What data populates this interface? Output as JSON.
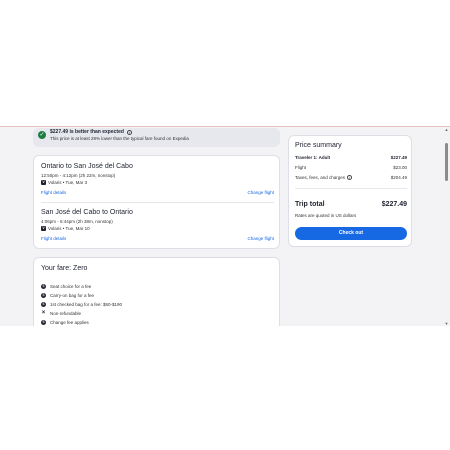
{
  "banner": {
    "title": "$227.49 is better than expected",
    "subtitle": "This price is at least 29% lower than the typical fare found on Expedia"
  },
  "flights": [
    {
      "route": "Ontario to San José del Cabo",
      "times": "12:50pm - 4:12pm (2h 22m, nonstop)",
      "carrier": "Volaris • Tue, Mar 3",
      "details_link": "Flight details",
      "change_link": "Change flight"
    },
    {
      "route": "San José del Cabo to Ontario",
      "times": "4:06pm - 6:44pm (2h 38m, nonstop)",
      "carrier": "Volaris • Tue, Mar 10",
      "details_link": "Flight details",
      "change_link": "Change flight"
    }
  ],
  "fare": {
    "heading": "Your fare: Zero",
    "items": [
      "Seat choice for a fee",
      "Carry-on bag for a fee",
      "1st checked bag for a fee: $50-$190",
      "Non-refundable",
      "Change fee applies"
    ]
  },
  "summary": {
    "heading": "Price summary",
    "traveler_label": "Traveler 1: Adult",
    "traveler_value": "$227.49",
    "flight_label": "Flight",
    "flight_value": "$23.00",
    "taxes_label": "Taxes, fees, and charges",
    "taxes_value": "$204.49",
    "total_label": "Trip total",
    "total_value": "$227.49",
    "rates_note": "Rates are quoted in US dollars",
    "checkout_label": "Check out"
  },
  "colors": {
    "accent": "#1668e3",
    "success": "#1e7d43",
    "banner_bg": "#e6e8ee",
    "page_bg": "#f3f3f5"
  }
}
